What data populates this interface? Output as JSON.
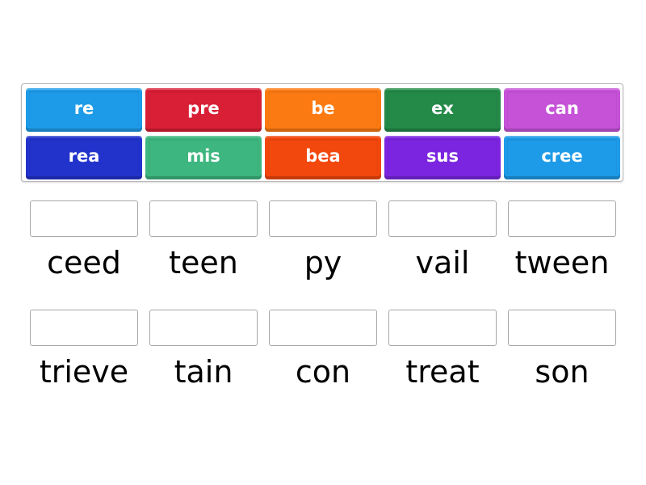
{
  "activity": {
    "type": "missing-word / drag prefixes to complete words"
  },
  "tiles": [
    {
      "label": "re",
      "color": "#1e9be8"
    },
    {
      "label": "pre",
      "color": "#d81f35"
    },
    {
      "label": "be",
      "color": "#fb7a12"
    },
    {
      "label": "ex",
      "color": "#248a48"
    },
    {
      "label": "can",
      "color": "#c652d8"
    },
    {
      "label": "rea",
      "color": "#2233cc"
    },
    {
      "label": "mis",
      "color": "#3db67f"
    },
    {
      "label": "bea",
      "color": "#f2470d"
    },
    {
      "label": "sus",
      "color": "#7b25e0"
    },
    {
      "label": "cree",
      "color": "#1e9be8"
    }
  ],
  "slots": [
    {
      "value": "",
      "stem": "ceed"
    },
    {
      "value": "",
      "stem": "teen"
    },
    {
      "value": "",
      "stem": "py"
    },
    {
      "value": "",
      "stem": "vail"
    },
    {
      "value": "",
      "stem": "tween"
    },
    {
      "value": "",
      "stem": "trieve"
    },
    {
      "value": "",
      "stem": "tain"
    },
    {
      "value": "",
      "stem": "con"
    },
    {
      "value": "",
      "stem": "treat"
    },
    {
      "value": "",
      "stem": "son"
    }
  ]
}
